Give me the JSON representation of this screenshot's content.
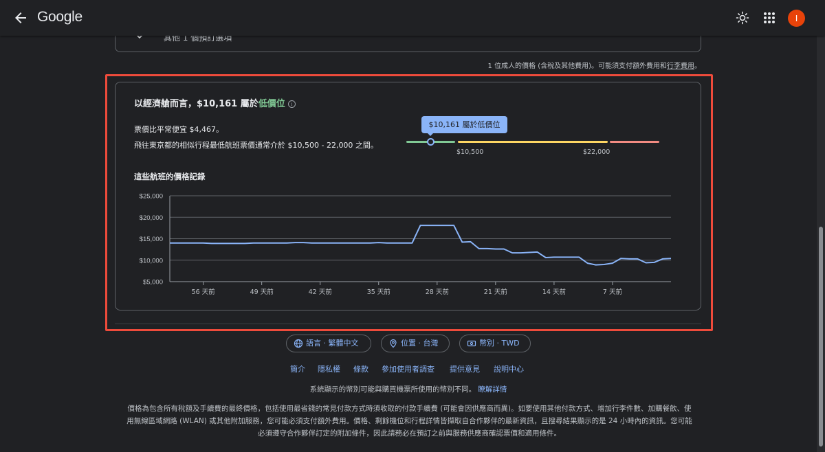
{
  "header": {
    "logo": "Google",
    "avatar_letter": "I"
  },
  "prev_card_text": "其他 1 個預訂選項",
  "price_note": {
    "text": "1 位成人的價格 (含稅及其他費用)。可能須支付額外費用和",
    "link": "行李費用",
    "suffix": "。"
  },
  "insight": {
    "title_prefix": "以經濟艙而言，$10,161 屬於",
    "title_level": "低價位",
    "cheaper_line": "票價比平常便宜 $4,467。",
    "range_line": "飛往東京都的相似行程最低航班票價通常介於 $10,500 - 22,000 之間。",
    "tooltip": "$10,161 屬於低價位",
    "range_low_label": "$10,500",
    "range_high_label": "$22,000",
    "history_title": "這些航班的價格記錄"
  },
  "colors": {
    "accent": "#8ab4f8",
    "low": "#81c995",
    "typical": "#fdd663",
    "high": "#f28b82",
    "highlight_border": "#ee4b3b"
  },
  "chart_data": {
    "type": "line",
    "title": "這些航班的價格記錄",
    "ylim": [
      5000,
      25000
    ],
    "y_ticks": [
      "$5,000",
      "$10,000",
      "$15,000",
      "$20,000",
      "$25,000"
    ],
    "y_tick_values": [
      5000,
      10000,
      15000,
      20000,
      25000
    ],
    "xlim": [
      -60,
      0
    ],
    "x_ticks": [
      "56 天前",
      "49 天前",
      "42 天前",
      "35 天前",
      "28 天前",
      "21 天前",
      "14 天前",
      "7 天前"
    ],
    "x_tick_values": [
      -56,
      -49,
      -42,
      -35,
      -28,
      -21,
      -14,
      -7
    ],
    "grid": true,
    "series": [
      {
        "color": "#8ab4f8",
        "points": [
          [
            -60,
            14000
          ],
          [
            -57,
            14000
          ],
          [
            -56,
            14000
          ],
          [
            -55,
            13900
          ],
          [
            -53,
            13900
          ],
          [
            -52,
            13900
          ],
          [
            -51,
            13900
          ],
          [
            -50,
            14000
          ],
          [
            -47,
            14000
          ],
          [
            -46,
            14000
          ],
          [
            -45,
            14100
          ],
          [
            -44,
            14100
          ],
          [
            -43,
            14000
          ],
          [
            -40,
            14000
          ],
          [
            -36,
            14000
          ],
          [
            -35,
            14100
          ],
          [
            -34,
            14000
          ],
          [
            -32,
            14000
          ],
          [
            -31,
            14000
          ],
          [
            -30,
            18100
          ],
          [
            -29,
            18100
          ],
          [
            -27,
            18100
          ],
          [
            -26,
            18100
          ],
          [
            -25,
            14200
          ],
          [
            -24,
            14300
          ],
          [
            -23,
            12700
          ],
          [
            -22,
            12700
          ],
          [
            -21,
            12600
          ],
          [
            -20,
            12600
          ],
          [
            -19,
            11700
          ],
          [
            -18,
            11700
          ],
          [
            -17,
            11800
          ],
          [
            -16,
            11900
          ],
          [
            -15,
            10600
          ],
          [
            -14,
            10700
          ],
          [
            -13,
            10700
          ],
          [
            -12,
            10700
          ],
          [
            -11,
            10700
          ],
          [
            -10,
            9300
          ],
          [
            -9,
            8900
          ],
          [
            -8,
            9000
          ],
          [
            -7,
            9300
          ],
          [
            -6,
            10400
          ],
          [
            -5,
            10300
          ],
          [
            -4,
            10300
          ],
          [
            -3,
            9400
          ],
          [
            -2,
            9500
          ],
          [
            -1,
            10300
          ],
          [
            0,
            10400
          ]
        ]
      }
    ]
  },
  "footer": {
    "chips": [
      "語言 · 繁體中文",
      "位置 · 台灣",
      "幣別 · TWD"
    ],
    "links": [
      "簡介",
      "隱私權",
      "條款",
      "參加使用者調查",
      "提供意見",
      "說明中心"
    ],
    "currency_note": "系統顯示的幣別可能與購買機票所使用的幣別不同。",
    "currency_note_link": "瞭解詳情",
    "disclaimer": "價格為包含所有稅額及手續費的最終價格，包括使用最省錢的常見付款方式時須收取的付款手續費 (可能會因供應商而異)。如要使用其他付款方式、增加行李件數、加購餐飲、使用無線區域網路 (WLAN) 或其他附加服務，您可能必須支付額外費用。價格、剩餘機位和行程詳情皆擷取自合作夥伴的最新資訊，且搜尋結果顯示的是 24 小時內的資訊。您可能必須遵守合作夥伴訂定的附加條件，因此請務必在預訂之前與服務供應商確認票價和適用條件。"
  }
}
